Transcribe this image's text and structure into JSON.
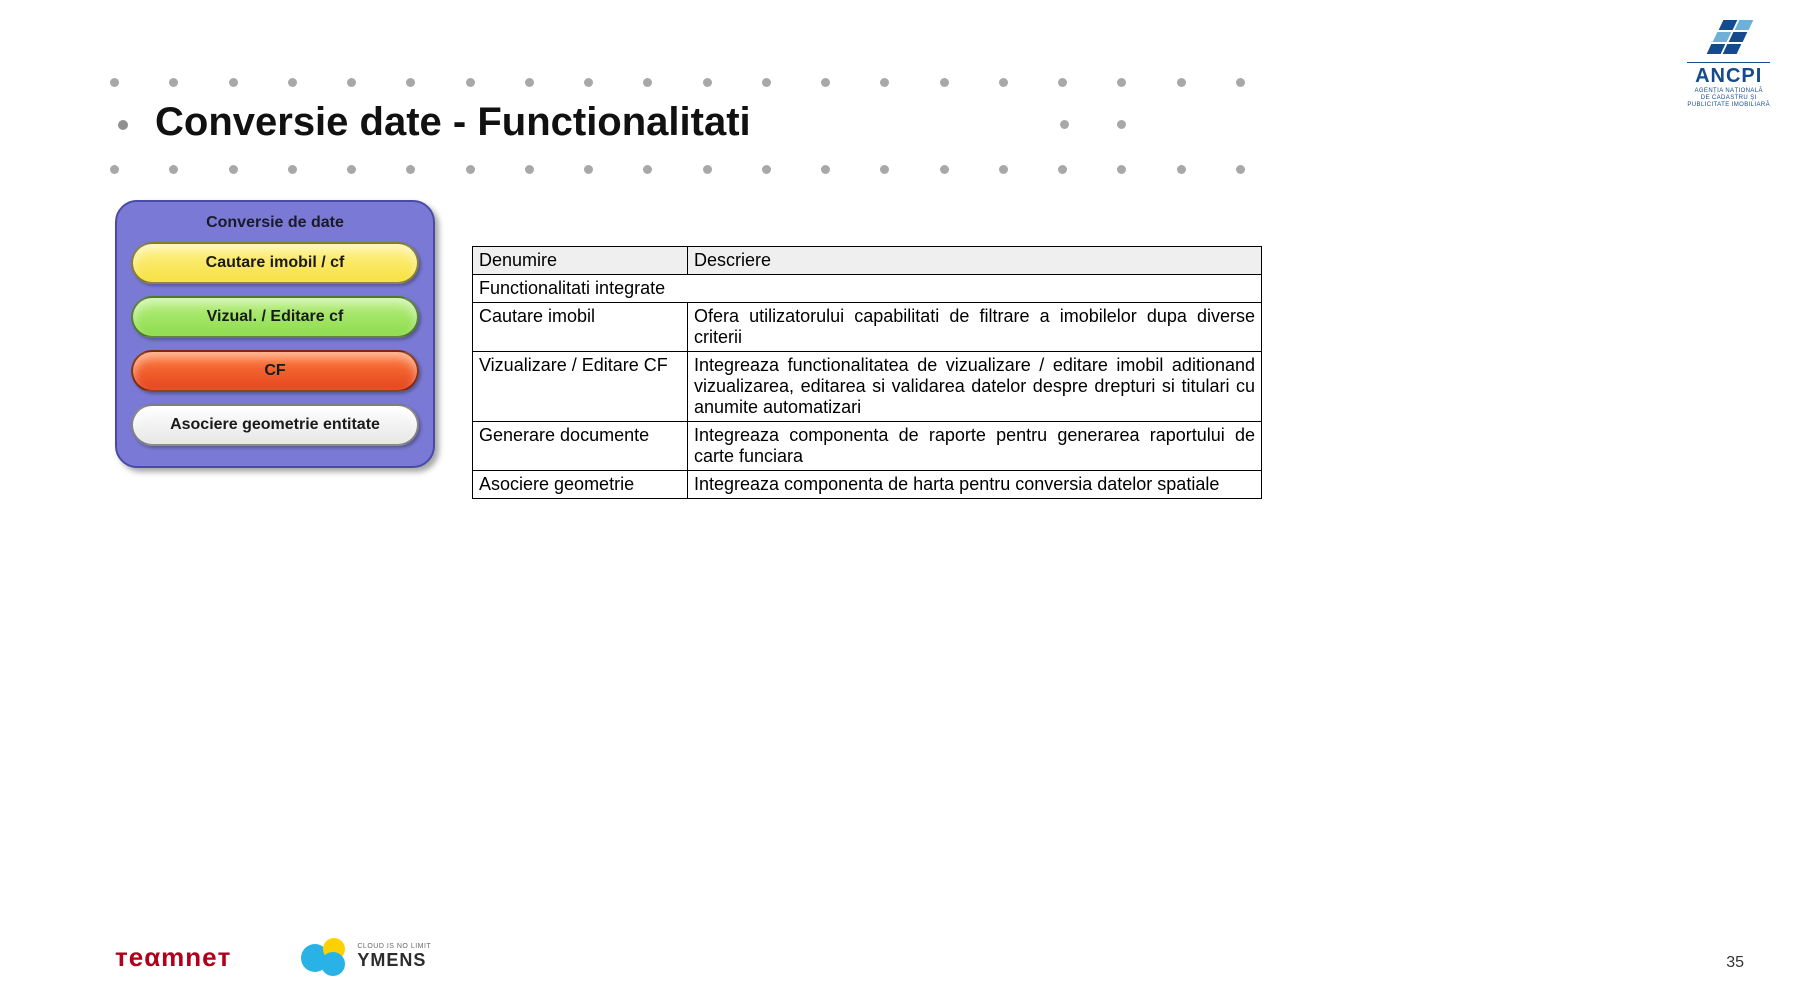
{
  "title": "Conversie date - Functionalitati",
  "top_logo": {
    "name": "ANCPI",
    "sub1": "AGENȚIA NAȚIONALĂ",
    "sub2": "DE CADASTRU ȘI",
    "sub3": "PUBLICITATE IMOBILIARĂ"
  },
  "panel": {
    "title": "Conversie de date",
    "pill0": "Cautare imobil / cf",
    "pill1": "Vizual. / Editare cf",
    "pill2": "CF",
    "pill3": "Asociere geometrie entitate"
  },
  "table": {
    "h0": "Denumire",
    "h1": "Descriere",
    "section": "Functionalitati integrate",
    "r0c0": "Cautare imobil",
    "r0c1": "Ofera utilizatorului capabilitati de filtrare a imobilelor dupa diverse criterii",
    "r1c0": "Vizualizare / Editare CF",
    "r1c1": "Integreaza functionalitatea de vizualizare / editare imobil aditionand vizualizarea, editarea si validarea datelor despre drepturi si titulari cu anumite automatizari",
    "r2c0": "Generare documente",
    "r2c1": "Integreaza componenta de raporte pentru generarea raportului de carte funciara",
    "r3c0": "Asociere geometrie",
    "r3c1": "Integreaza componenta de harta pentru conversia datelor spatiale"
  },
  "bottom_logos": {
    "teamnet": "тeαmneт",
    "ymens_small": "CLOUD IS NO LIMIT",
    "ymens": "YMENS"
  },
  "page_no": "35"
}
